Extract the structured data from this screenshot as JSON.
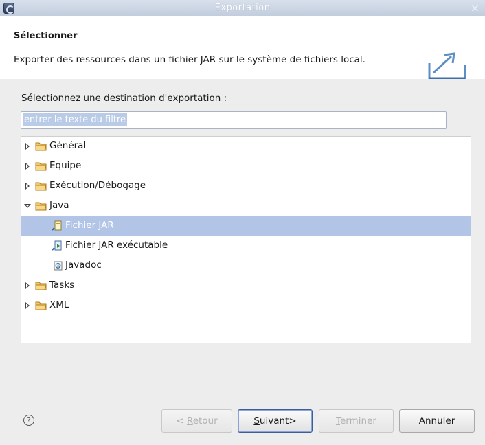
{
  "window": {
    "title": "Exportation",
    "close_glyph": "×"
  },
  "header": {
    "title": "Sélectionner",
    "description": "Exporter des ressources dans un fichier JAR sur le système de fichiers local."
  },
  "destination": {
    "label_pre": "Sélectionnez une destination d'e",
    "label_mnemonic": "x",
    "label_post": "portation :",
    "filter_value": "entrer le texte du filtre"
  },
  "tree": {
    "items": [
      {
        "label": "Général",
        "icon": "folder-icon",
        "expander": "collapsed",
        "level": 0
      },
      {
        "label": "Equipe",
        "icon": "folder-icon",
        "expander": "collapsed",
        "level": 0
      },
      {
        "label": "Exécution/Débogage",
        "icon": "folder-icon",
        "expander": "collapsed",
        "level": 0
      },
      {
        "label": "Java",
        "icon": "folder-icon",
        "expander": "expanded",
        "level": 0
      },
      {
        "label": "Fichier JAR",
        "icon": "jar-file-icon",
        "expander": "none",
        "level": 1,
        "selected": true
      },
      {
        "label": "Fichier JAR exécutable",
        "icon": "runnable-jar-icon",
        "expander": "none",
        "level": 1
      },
      {
        "label": "Javadoc",
        "icon": "javadoc-icon",
        "expander": "none",
        "level": 1
      },
      {
        "label": "Tasks",
        "icon": "folder-icon",
        "expander": "collapsed",
        "level": 0
      },
      {
        "label": "XML",
        "icon": "folder-icon",
        "expander": "collapsed",
        "level": 0
      }
    ]
  },
  "footer": {
    "help_glyph": "?",
    "back": {
      "pre": "< ",
      "mnemonic": "R",
      "post": "etour"
    },
    "next": {
      "pre": "",
      "mnemonic": "S",
      "post": "uivant>"
    },
    "finish": {
      "pre": "",
      "mnemonic": "T",
      "post": "erminer"
    },
    "cancel": {
      "label": "Annuler"
    }
  },
  "colors": {
    "selection": "#b3c5e6",
    "folder": "#e8b04a",
    "titlebar": "#c8d2e2"
  }
}
